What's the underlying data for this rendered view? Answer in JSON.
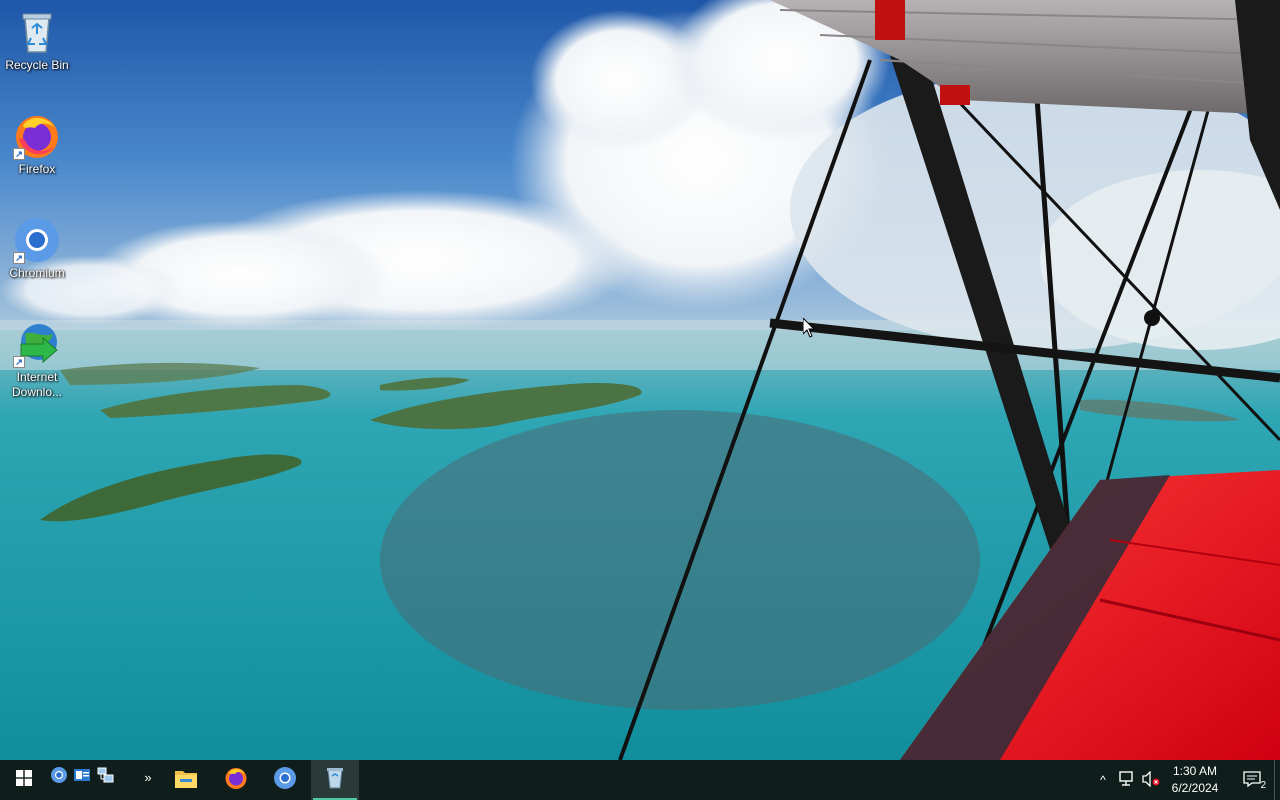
{
  "desktop": {
    "icons": [
      {
        "label": "Recycle Bin",
        "icon": "recycle-bin-icon"
      },
      {
        "label": "Firefox",
        "icon": "firefox-icon"
      },
      {
        "label": "Chromium",
        "icon": "chromium-icon"
      },
      {
        "label": "Internet Downlo...",
        "icon": "internet-download-manager-icon"
      }
    ]
  },
  "taskbar": {
    "start": {
      "icon": "windows-start-icon"
    },
    "quick_launch": [
      {
        "icon": "chromium-quick-icon"
      },
      {
        "icon": "outlook-quick-icon"
      },
      {
        "icon": "network-quick-icon"
      },
      {
        "icon": "overflow-chevron-icon",
        "label": "»"
      }
    ],
    "apps": [
      {
        "icon": "file-explorer-icon"
      },
      {
        "icon": "firefox-icon"
      },
      {
        "icon": "chromium-icon"
      },
      {
        "icon": "recycle-bin-icon",
        "active": true
      }
    ],
    "tray": {
      "show_hidden_icon": "^",
      "network_icon": "network-icon",
      "volume_icon": "volume-muted-icon",
      "time": "1:30 AM",
      "date": "6/2/2024",
      "notification_count": "2"
    }
  },
  "colors": {
    "taskbar_bg": "#0f1d1b",
    "active_indicator": "#4ec9a0",
    "sky": "#2b6fc0",
    "sea": "#1a9aa8",
    "wing_red": "#e01020"
  }
}
